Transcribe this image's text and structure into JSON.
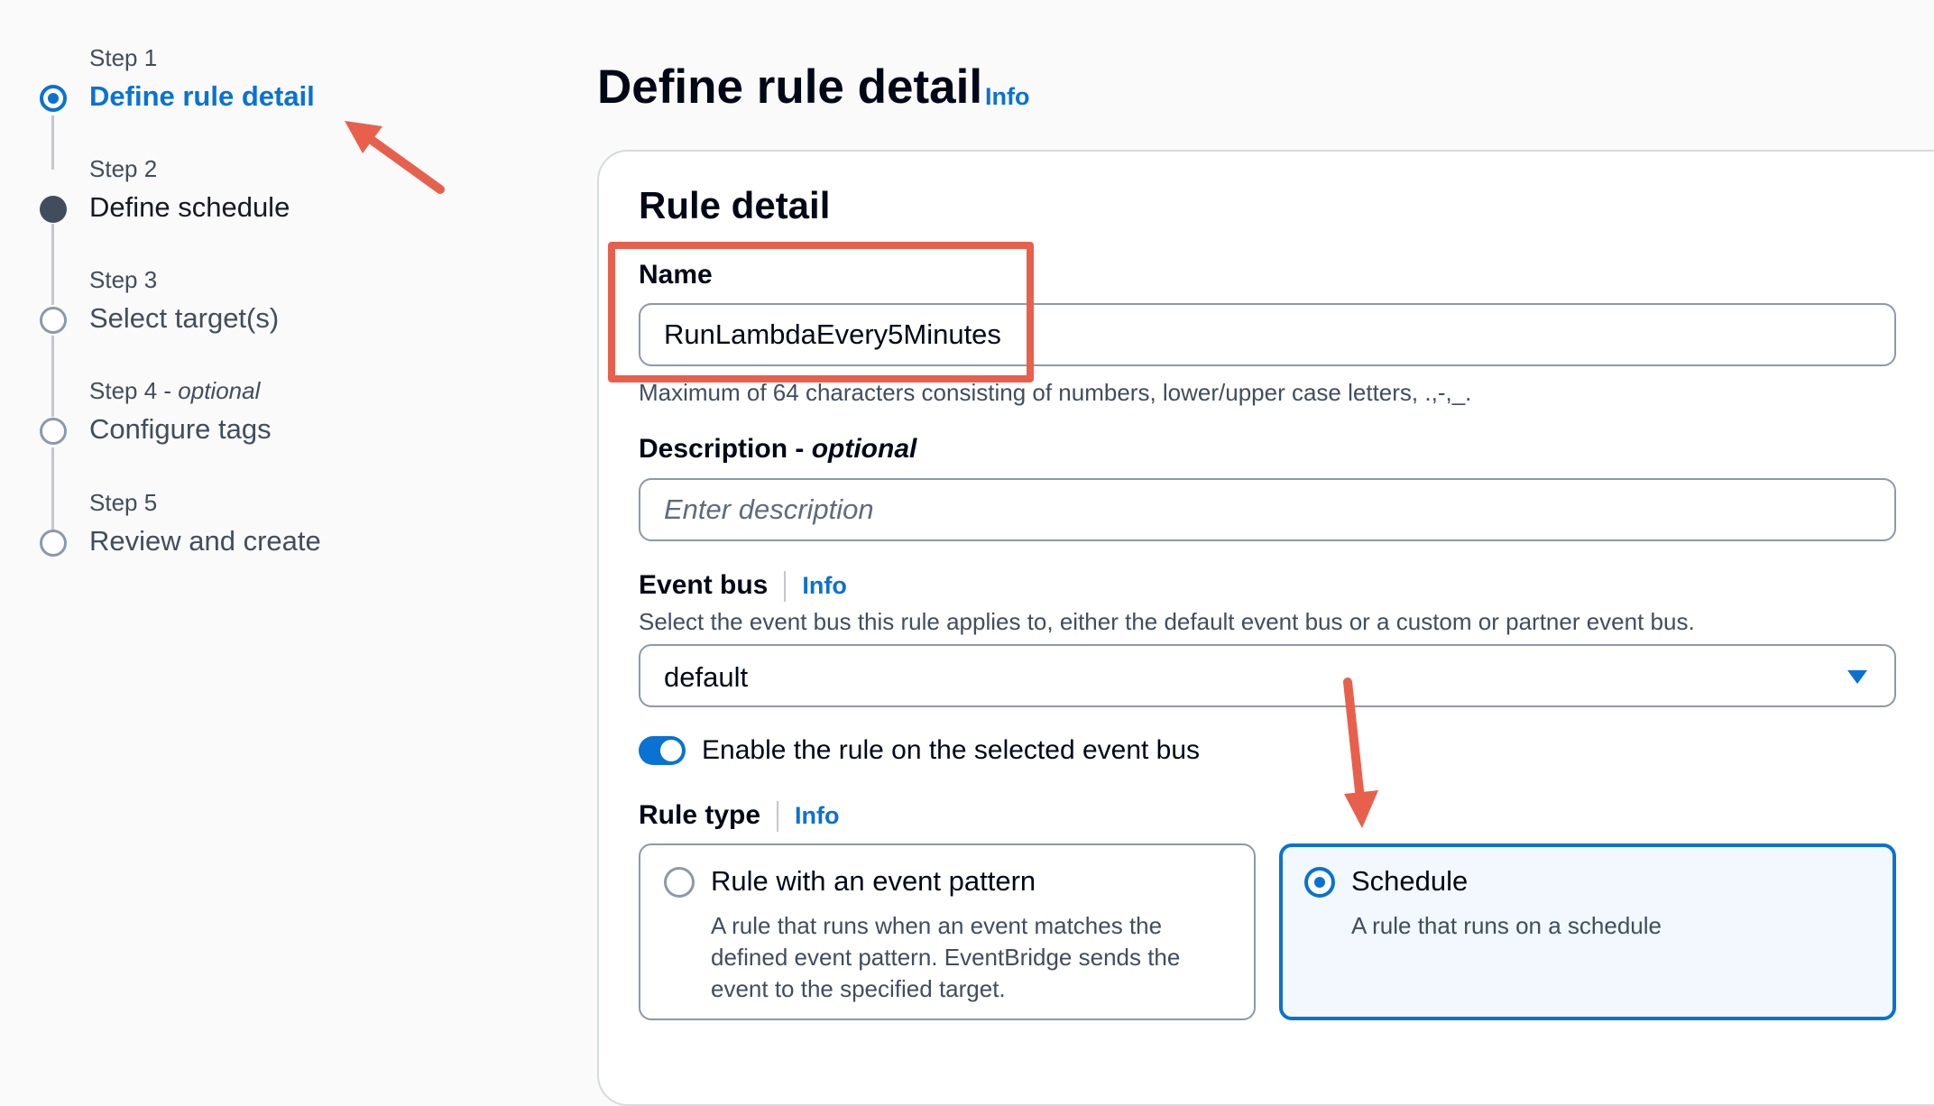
{
  "wizard": {
    "steps": [
      {
        "label": "Step 1",
        "label_suffix": "",
        "title": "Define rule detail",
        "state": "active"
      },
      {
        "label": "Step 2",
        "label_suffix": "",
        "title": "Define schedule",
        "state": "done"
      },
      {
        "label": "Step 3",
        "label_suffix": "",
        "title": "Select target(s)",
        "state": "todo"
      },
      {
        "label": "Step 4 - ",
        "label_suffix": "optional",
        "title": "Configure tags",
        "state": "todo"
      },
      {
        "label": "Step 5",
        "label_suffix": "",
        "title": "Review and create",
        "state": "todo"
      }
    ]
  },
  "header": {
    "title": "Define rule detail",
    "info": "Info"
  },
  "panel": {
    "title": "Rule detail",
    "name": {
      "label": "Name",
      "value": "RunLambdaEvery5Minutes",
      "constraint": "Maximum of 64 characters consisting of numbers, lower/upper case letters, .,-,_."
    },
    "description": {
      "label": "Description - ",
      "label_suffix": "optional",
      "placeholder": "Enter description"
    },
    "event_bus": {
      "label": "Event bus",
      "info": "Info",
      "help": "Select the event bus this rule applies to, either the default event bus or a custom or partner event bus.",
      "selected": "default"
    },
    "enable_toggle": {
      "label": "Enable the rule on the selected event bus",
      "enabled": true
    },
    "rule_type": {
      "label": "Rule type",
      "info": "Info",
      "options": [
        {
          "title": "Rule with an event pattern",
          "description": "A rule that runs when an event matches the defined event pattern. EventBridge sends the event to the specified target.",
          "selected": false
        },
        {
          "title": "Schedule",
          "description": "A rule that runs on a schedule",
          "selected": true
        }
      ]
    }
  },
  "colors": {
    "accent": "#0972d3",
    "annotation": "#e8604c",
    "text": "#16191f",
    "muted": "#414d5c"
  }
}
